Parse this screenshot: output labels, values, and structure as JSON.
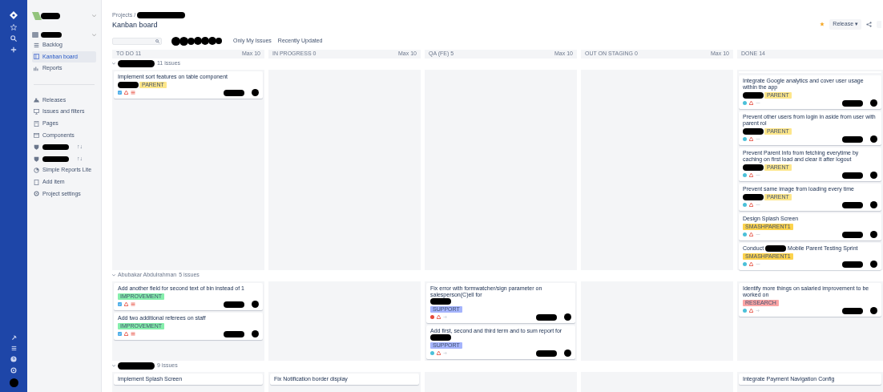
{
  "sidebar": {
    "items": [
      {
        "kind": "link",
        "label": "Backlog",
        "selected": false
      },
      {
        "kind": "link",
        "label": "Kanban board",
        "selected": true
      },
      {
        "kind": "link",
        "label": "Reports",
        "selected": false
      },
      {
        "kind": "divider"
      },
      {
        "kind": "link",
        "label": "Releases",
        "selected": false
      },
      {
        "kind": "link",
        "label": "Issues and filters",
        "selected": false
      },
      {
        "kind": "link",
        "label": "Pages",
        "selected": false
      },
      {
        "kind": "link",
        "label": "Components",
        "selected": false
      },
      {
        "kind": "redacted",
        "badge": "↑↓",
        "selected": false
      },
      {
        "kind": "redacted",
        "badge": "↑↓",
        "selected": false
      },
      {
        "kind": "link",
        "label": "Simple Reports Lite",
        "selected": false
      },
      {
        "kind": "link",
        "label": "Add item",
        "selected": false
      },
      {
        "kind": "link",
        "label": "Project settings",
        "selected": false
      }
    ]
  },
  "breadcrumb": "Projects /",
  "title": "Kanban board",
  "header": {
    "starred": true,
    "release_button": "Release ▾"
  },
  "filters": [
    "Only My Issues",
    "Recently Updated"
  ],
  "columns": [
    {
      "name": "TO DO 11",
      "limit": "Max 10"
    },
    {
      "name": "IN PROGRESS 0",
      "limit": "Max 10"
    },
    {
      "name": "QA (FE) 5",
      "limit": "Max 10"
    },
    {
      "name": "OUT ON STAGING 0",
      "limit": "Max 10"
    },
    {
      "name": "DONE 14"
    }
  ],
  "swimlanes": [
    {
      "name_redacted": true,
      "count": "11 issues",
      "columns": [
        [
          {
            "title": [
              {
                "text": "Implement sort features on table component"
              }
            ],
            "label": {
              "prefix_redacted": true,
              "text": "PARENT",
              "color": "#fde68a"
            },
            "kind": "task"
          }
        ],
        [],
        [],
        [],
        [
          {
            "title": [
              {
                "text": "Integrate Google analytics and cover user usage within the app"
              }
            ],
            "label": {
              "prefix_redacted": true,
              "text": "PARENT",
              "color": "#fde68a"
            },
            "kind": "subtask"
          },
          {
            "title": [
              {
                "text": "Prevent other users from login in aside from user with parent rol"
              }
            ],
            "label": {
              "prefix_redacted": true,
              "text": "PARENT",
              "color": "#fde68a"
            },
            "kind": "subtask"
          },
          {
            "title": [
              {
                "text": "Prevent Parent Info from fetching everytime by caching on first load and clear it after logout"
              }
            ],
            "label": {
              "prefix_redacted": true,
              "text": "PARENT",
              "color": "#fde68a"
            },
            "kind": "subtask"
          },
          {
            "title": [
              {
                "text": "Prevent same image from loading every time"
              }
            ],
            "label": {
              "prefix_redacted": true,
              "text": "PARENT",
              "color": "#fde68a"
            },
            "kind": "subtask"
          },
          {
            "title": [
              {
                "text": "Design Splash Screen"
              }
            ],
            "label": {
              "prefix_redacted": false,
              "text": "SMASHPARENT1",
              "color": "#fcd34d"
            },
            "kind": "subtask"
          },
          {
            "title": [
              {
                "text": "Conduct"
              },
              {
                "kind": "redaction"
              },
              {
                "text": "Mobile Parent Testing Sprint"
              }
            ],
            "label": {
              "prefix_redacted": false,
              "text": "SMASHPARENT1",
              "color": "#fcd34d"
            },
            "kind": "subtask"
          }
        ]
      ]
    },
    {
      "name": "Abubakar Abdulrahman",
      "count": "5 issues",
      "columns": [
        [
          {
            "title": [
              {
                "text": "Add another field for second text of bin instead of 1"
              }
            ],
            "label": {
              "prefix_redacted": false,
              "text": "IMPROVEMENT",
              "color": "#86efac"
            },
            "kind": "task"
          },
          {
            "title": [
              {
                "text": "Add two additional referees on staff"
              }
            ],
            "label": {
              "prefix_redacted": false,
              "text": "IMPROVEMENT",
              "color": "#86efac"
            },
            "kind": "task"
          }
        ],
        [],
        [
          {
            "title": [
              {
                "text": "Fix error with formwatcher/sign parameter on salesperson(C)ell for"
              },
              {
                "kind": "redaction"
              }
            ],
            "label": {
              "prefix_redacted": false,
              "text": "SUPPORT",
              "color": "#a5b4fc"
            },
            "kind": "bug"
          },
          {
            "title": [
              {
                "text": "Add first, second and third term and to sum report for"
              },
              {
                "kind": "redaction"
              }
            ],
            "label": {
              "prefix_redacted": false,
              "text": "SUPPORT",
              "color": "#a5b4fc"
            },
            "kind": "followup"
          }
        ],
        [],
        [
          {
            "title": [
              {
                "text": "Identify more things on salaried improvement to be worked on"
              }
            ],
            "label": {
              "prefix_redacted": false,
              "text": "RESEARCH",
              "color": "#fca5a5"
            },
            "kind": "followup"
          }
        ]
      ]
    },
    {
      "name_redacted": true,
      "count": "9 issues",
      "columns": [
        [
          {
            "title": [
              {
                "text": "Implement Splash Screen"
              }
            ]
          }
        ],
        [
          {
            "title": [
              {
                "text": "Fix Notification border display"
              }
            ]
          }
        ],
        [],
        [],
        [
          {
            "title": [
              {
                "text": "Integrate Payment Navigation Config"
              }
            ]
          }
        ]
      ]
    }
  ]
}
